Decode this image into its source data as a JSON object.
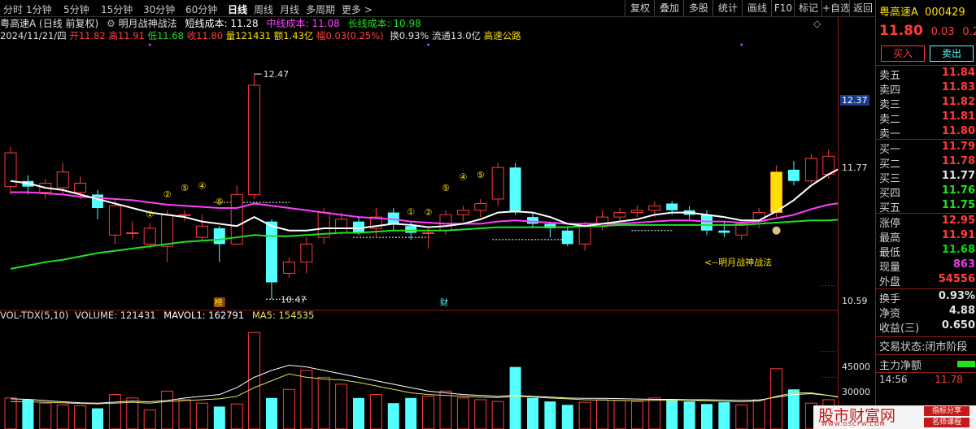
{
  "periods": [
    "分时",
    "1分钟",
    "5分钟",
    "15分钟",
    "30分钟",
    "60分钟",
    "日线",
    "周线",
    "月线",
    "多周期",
    "更多 >"
  ],
  "active_period": "日线",
  "toolbar_right": [
    "复权",
    "叠加",
    "多股",
    "统计",
    "画线",
    "F10",
    "标记",
    "+自选",
    "返回"
  ],
  "info": {
    "title": "粤高速A (日线 前复权)",
    "indicator_name": "明月战神战法",
    "short_cost": "短线成本: 11.28",
    "mid_cost": "中线成本: 11.08",
    "long_cost": "长线成本: 10.98"
  },
  "quote_line": {
    "date": "2024/11/21/四",
    "open": "开11.82",
    "high": "高11.91",
    "low": "低11.68",
    "close": "收11.80",
    "volume": "量121431",
    "amount": "额1.43亿",
    "change": "幅0.03(0.25%)",
    "turnover": "换0.93%",
    "float": "流通13.0亿",
    "sector": "高速公路"
  },
  "axis_labels": [
    {
      "label": "12.37",
      "price": 12.37,
      "boxed": true
    },
    {
      "label": "11.77",
      "price": 11.77
    },
    {
      "label": "10.59",
      "price": 10.59
    },
    {
      "label": "45000",
      "vol": 45000
    },
    {
      "label": "30000",
      "vol": 30000
    }
  ],
  "chart_annotations": {
    "high_label": "12.47",
    "low_label": "10.47",
    "strategy_label": "<--明月战神战法",
    "tag_bang": "榜",
    "tag_cai": "财"
  },
  "vol_line": {
    "name": "VOL-TDX(5,10)",
    "volume": "VOLUME: 121431",
    "mavol1": "MAVOL1: 162791",
    "ma5": "MA5: 154535"
  },
  "stock": {
    "name": "粤高速A",
    "code": "000429",
    "price": "11.80",
    "change": "0.03",
    "pct": "0.25"
  },
  "trade_buttons": {
    "buy": "买入",
    "sell": "卖出"
  },
  "asks": [
    {
      "name": "卖五",
      "price": "11.84"
    },
    {
      "name": "卖四",
      "price": "11.83"
    },
    {
      "name": "卖三",
      "price": "11.82"
    },
    {
      "name": "卖二",
      "price": "11.81"
    },
    {
      "name": "卖一",
      "price": "11.80"
    }
  ],
  "bids": [
    {
      "name": "买一",
      "price": "11.79"
    },
    {
      "name": "买二",
      "price": "11.78"
    },
    {
      "name": "买三",
      "price": "11.77"
    },
    {
      "name": "买四",
      "price": "11.76"
    },
    {
      "name": "买五",
      "price": "11.75"
    }
  ],
  "stats": [
    {
      "name": "涨停",
      "value": "12.95",
      "color": "#ff4040"
    },
    {
      "name": "最高",
      "value": "11.91",
      "color": "#ff4040"
    },
    {
      "name": "最低",
      "value": "11.68",
      "color": "#00e000"
    },
    {
      "name": "现量",
      "value": "863",
      "color": "#e040e0"
    },
    {
      "name": "外盘",
      "value": "54556",
      "color": "#ff4040"
    }
  ],
  "stats2": [
    {
      "name": "换手",
      "value": "0.93%"
    },
    {
      "name": "净资",
      "value": "4.88"
    },
    {
      "name": "收益(三)",
      "value": "0.650"
    }
  ],
  "status": {
    "label": "交易状态:",
    "value": "闭市阶段"
  },
  "main_flow": "主力净额",
  "tick": {
    "time": "14:56",
    "price": "11.78"
  },
  "watermark": {
    "text": "股市财富网",
    "url": "WWW.GSCFW.COM",
    "tag1": "指标分享",
    "tag2": "名师课程"
  },
  "colors": {
    "up": "#ff3b3b",
    "down": "#54ffff",
    "ma_short": "#ffffff",
    "ma_mid": "#ff40ff",
    "ma_long": "#20e020",
    "signal": "#ffe000",
    "mavol1": "#ffffff",
    "ma5": "#e0e060"
  },
  "chart_data": {
    "type": "candlestick",
    "y_range": [
      10.4,
      12.55
    ],
    "candles": [
      {
        "o": 11.47,
        "c": 11.77,
        "h": 11.82,
        "l": 11.4
      },
      {
        "o": 11.52,
        "c": 11.47,
        "h": 11.57,
        "l": 11.4
      },
      {
        "o": 11.42,
        "c": 11.5,
        "h": 11.54,
        "l": 11.36
      },
      {
        "o": 11.46,
        "c": 11.6,
        "h": 11.68,
        "l": 11.4
      },
      {
        "o": 11.42,
        "c": 11.5,
        "h": 11.56,
        "l": 11.36
      },
      {
        "o": 11.4,
        "c": 11.28,
        "h": 11.44,
        "l": 11.18
      },
      {
        "o": 11.04,
        "c": 11.3,
        "h": 11.36,
        "l": 10.96
      },
      {
        "o": 11.06,
        "c": 11.06,
        "h": 11.16,
        "l": 11.0
      },
      {
        "o": 10.96,
        "c": 11.1,
        "h": 11.14,
        "l": 10.92
      },
      {
        "o": 10.94,
        "c": 11.22,
        "h": 11.26,
        "l": 10.8
      },
      {
        "o": 11.22,
        "c": 11.22,
        "h": 11.26,
        "l": 11.16
      },
      {
        "o": 11.02,
        "c": 11.12,
        "h": 11.22,
        "l": 11.0
      },
      {
        "o": 11.1,
        "c": 10.96,
        "h": 11.12,
        "l": 10.8
      },
      {
        "o": 10.96,
        "c": 11.4,
        "h": 11.48,
        "l": 10.96
      },
      {
        "o": 11.4,
        "c": 12.37,
        "h": 12.47,
        "l": 11.36
      },
      {
        "o": 11.16,
        "c": 10.62,
        "h": 11.18,
        "l": 10.47
      },
      {
        "o": 10.7,
        "c": 10.8,
        "h": 10.84,
        "l": 10.66
      },
      {
        "o": 10.8,
        "c": 10.96,
        "h": 11.02,
        "l": 10.7
      },
      {
        "o": 11.02,
        "c": 11.24,
        "h": 11.28,
        "l": 10.96
      },
      {
        "o": 11.06,
        "c": 11.18,
        "h": 11.24,
        "l": 11.04
      },
      {
        "o": 11.16,
        "c": 11.06,
        "h": 11.2,
        "l": 11.04
      },
      {
        "o": 11.1,
        "c": 11.2,
        "h": 11.28,
        "l": 11.02
      },
      {
        "o": 11.24,
        "c": 11.14,
        "h": 11.28,
        "l": 11.08
      },
      {
        "o": 11.12,
        "c": 11.06,
        "h": 11.16,
        "l": 11.0
      },
      {
        "o": 11.06,
        "c": 11.06,
        "h": 11.1,
        "l": 10.92
      },
      {
        "o": 11.08,
        "c": 11.22,
        "h": 11.26,
        "l": 11.04
      },
      {
        "o": 11.22,
        "c": 11.26,
        "h": 11.3,
        "l": 11.16
      },
      {
        "o": 11.26,
        "c": 11.32,
        "h": 11.36,
        "l": 11.2
      },
      {
        "o": 11.36,
        "c": 11.64,
        "h": 11.68,
        "l": 11.3
      },
      {
        "o": 11.64,
        "c": 11.24,
        "h": 11.68,
        "l": 11.22
      },
      {
        "o": 11.2,
        "c": 11.14,
        "h": 11.24,
        "l": 11.1
      },
      {
        "o": 11.14,
        "c": 11.1,
        "h": 11.16,
        "l": 11.02
      },
      {
        "o": 11.08,
        "c": 10.96,
        "h": 11.12,
        "l": 10.94
      },
      {
        "o": 10.96,
        "c": 11.12,
        "h": 11.16,
        "l": 10.9
      },
      {
        "o": 11.12,
        "c": 11.2,
        "h": 11.26,
        "l": 11.08
      },
      {
        "o": 11.2,
        "c": 11.24,
        "h": 11.28,
        "l": 11.16
      },
      {
        "o": 11.24,
        "c": 11.26,
        "h": 11.3,
        "l": 11.2
      },
      {
        "o": 11.26,
        "c": 11.3,
        "h": 11.34,
        "l": 11.2
      },
      {
        "o": 11.32,
        "c": 11.26,
        "h": 11.34,
        "l": 11.22
      },
      {
        "o": 11.26,
        "c": 11.22,
        "h": 11.3,
        "l": 11.18
      },
      {
        "o": 11.22,
        "c": 11.08,
        "h": 11.26,
        "l": 11.04
      },
      {
        "o": 11.08,
        "c": 11.06,
        "h": 11.16,
        "l": 11.02
      },
      {
        "o": 11.04,
        "c": 11.14,
        "h": 11.18,
        "l": 11.0
      },
      {
        "o": 11.14,
        "c": 11.24,
        "h": 11.28,
        "l": 11.1
      },
      {
        "o": 11.24,
        "c": 11.6,
        "h": 11.66,
        "l": 11.2
      },
      {
        "o": 11.62,
        "c": 11.52,
        "h": 11.7,
        "l": 11.48
      },
      {
        "o": 11.52,
        "c": 11.72,
        "h": 11.76,
        "l": 11.5
      },
      {
        "o": 11.58,
        "c": 11.74,
        "h": 11.8,
        "l": 11.54
      },
      {
        "o": 11.82,
        "c": 11.8,
        "h": 11.91,
        "l": 11.68
      }
    ],
    "ma_short": [
      11.52,
      11.5,
      11.46,
      11.44,
      11.4,
      11.36,
      11.32,
      11.28,
      11.24,
      11.22,
      11.2,
      11.16,
      11.14,
      11.12,
      11.2,
      11.12,
      11.08,
      11.08,
      11.1,
      11.1,
      11.1,
      11.12,
      11.14,
      11.13,
      11.11,
      11.12,
      11.14,
      11.18,
      11.24,
      11.25,
      11.24,
      11.2,
      11.14,
      11.12,
      11.14,
      11.16,
      11.18,
      11.22,
      11.24,
      11.24,
      11.22,
      11.2,
      11.17,
      11.17,
      11.25,
      11.35,
      11.48,
      11.58,
      11.66
    ],
    "ma_mid": [
      11.42,
      11.42,
      11.41,
      11.4,
      11.38,
      11.37,
      11.36,
      11.35,
      11.33,
      11.31,
      11.3,
      11.29,
      11.28,
      11.28,
      11.32,
      11.3,
      11.28,
      11.26,
      11.24,
      11.22,
      11.2,
      11.19,
      11.18,
      11.16,
      11.15,
      11.14,
      11.14,
      11.14,
      11.16,
      11.17,
      11.16,
      11.15,
      11.14,
      11.14,
      11.14,
      11.14,
      11.15,
      11.16,
      11.17,
      11.17,
      11.16,
      11.16,
      11.15,
      11.16,
      11.19,
      11.22,
      11.27,
      11.31,
      11.33
    ],
    "ma_long": [
      10.74,
      10.77,
      10.8,
      10.82,
      10.85,
      10.88,
      10.9,
      10.92,
      10.94,
      10.96,
      10.98,
      10.99,
      11.0,
      11.02,
      11.04,
      11.03,
      11.03,
      11.04,
      11.05,
      11.06,
      11.06,
      11.07,
      11.08,
      11.08,
      11.08,
      11.08,
      11.09,
      11.1,
      11.11,
      11.11,
      11.11,
      11.11,
      11.11,
      11.12,
      11.12,
      11.13,
      11.13,
      11.13,
      11.13,
      11.13,
      11.13,
      11.13,
      11.13,
      11.14,
      11.15,
      11.16,
      11.17,
      11.17,
      11.18
    ],
    "signals": [
      {
        "i": 8,
        "label": "①"
      },
      {
        "i": 9,
        "label": "②"
      },
      {
        "i": 10,
        "label": "⑤"
      },
      {
        "i": 11,
        "label": "④"
      },
      {
        "i": 12,
        "label": "⑤"
      },
      {
        "i": 23,
        "label": "①"
      },
      {
        "i": 24,
        "label": "②"
      },
      {
        "i": 25,
        "label": "⑤"
      },
      {
        "i": 26,
        "label": "④"
      },
      {
        "i": 27,
        "label": "⑤"
      }
    ],
    "signal_bar": {
      "i": 44,
      "from": 11.24,
      "to": 11.6
    },
    "volume_range": [
      0,
      58000
    ],
    "volumes": [
      18000,
      17000,
      15000,
      14000,
      13500,
      12000,
      20000,
      18000,
      11000,
      22000,
      17000,
      15000,
      13000,
      14500,
      56000,
      18000,
      23000,
      34000,
      30000,
      26000,
      18000,
      20000,
      15000,
      18000,
      19000,
      22000,
      18000,
      17000,
      16000,
      36000,
      18000,
      16000,
      14000,
      15500,
      17000,
      16500,
      16000,
      18000,
      17000,
      16000,
      14500,
      15500,
      14000,
      17000,
      35000,
      23000,
      15000,
      17000,
      14000
    ],
    "mavol1": [
      17500,
      17200,
      16500,
      15800,
      15200,
      15000,
      15600,
      16200,
      15800,
      16500,
      18000,
      19000,
      20000,
      24000,
      30000,
      34000,
      37000,
      36000,
      34000,
      32000,
      30000,
      28000,
      26000,
      24000,
      22000,
      21000,
      20000,
      19500,
      19000,
      19500,
      19000,
      18500,
      18000,
      17800,
      17800,
      17600,
      17400,
      17200,
      17200,
      17000,
      17000,
      16800,
      16600,
      16800,
      18500,
      20000,
      20500,
      19500,
      18000
    ],
    "ma5": [
      16000,
      15800,
      15500,
      15200,
      14800,
      14600,
      15000,
      15500,
      15000,
      16000,
      16500,
      17000,
      17500,
      19000,
      24000,
      28000,
      32000,
      30000,
      29000,
      28500,
      27000,
      25000,
      23000,
      21000,
      20000,
      19500,
      19000,
      18500,
      18200,
      19000,
      18500,
      18000,
      17500,
      17000,
      16800,
      16600,
      16400,
      16600,
      16800,
      16600,
      16400,
      16000,
      15800,
      16200,
      19000,
      21000,
      21000,
      19500,
      17500
    ]
  }
}
